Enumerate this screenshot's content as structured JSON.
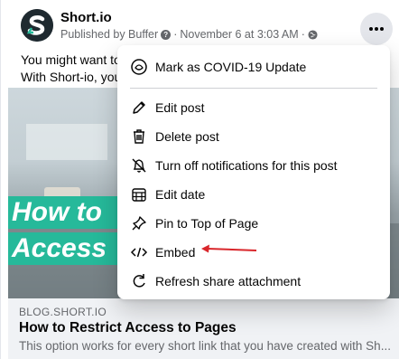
{
  "post": {
    "page_name": "Short.io",
    "meta": {
      "published_by": "Published by Buffer",
      "separator": "·",
      "date": "November 6 at 3:03 AM",
      "separator2": "·"
    },
    "text_line1": "You might want to",
    "text_line2": "With Short-io, you",
    "image_overlay": {
      "line1": "How to",
      "line2": "Access"
    },
    "link": {
      "domain": "BLOG.SHORT.IO",
      "title": "How to Restrict Access to Pages",
      "description": "This option works for every short link that you have created with Sh..."
    }
  },
  "dropdown": {
    "items": [
      {
        "label": "Mark as COVID-19 Update",
        "icon": "covid-update-icon"
      },
      {
        "label": "Edit post",
        "icon": "pencil-icon"
      },
      {
        "label": "Delete post",
        "icon": "trash-icon"
      },
      {
        "label": "Turn off notifications for this post",
        "icon": "bell-off-icon"
      },
      {
        "label": "Edit date",
        "icon": "calendar-icon"
      },
      {
        "label": "Pin to Top of Page",
        "icon": "pin-icon"
      },
      {
        "label": "Embed",
        "icon": "code-icon"
      },
      {
        "label": "Refresh share attachment",
        "icon": "refresh-icon"
      }
    ]
  },
  "colors": {
    "accent_green": "#26b99a",
    "arrow_red": "#d9262b",
    "text_secondary": "#65676b"
  }
}
